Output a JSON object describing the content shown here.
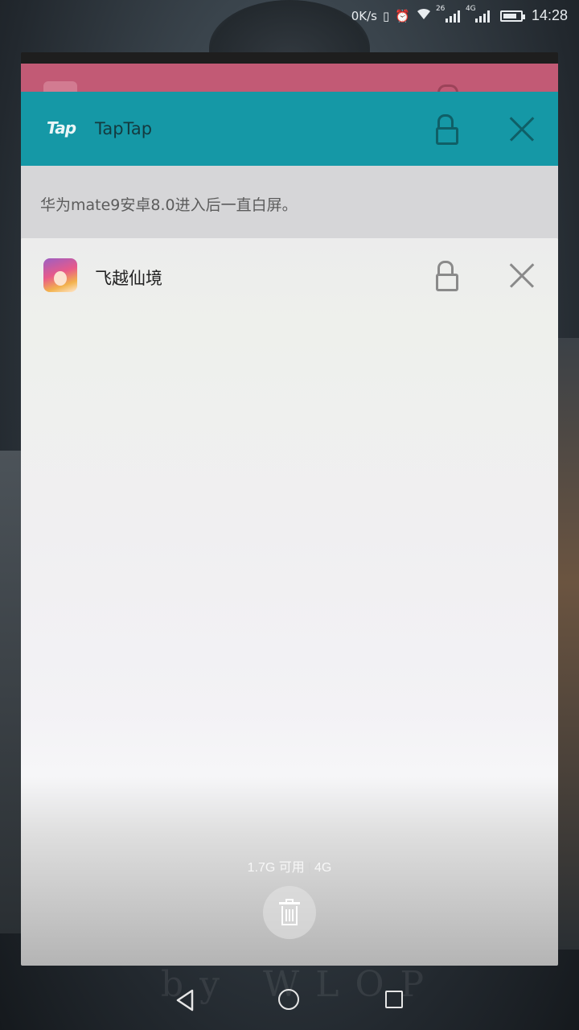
{
  "status_bar": {
    "net_speed": "0K/s",
    "sim1_label": "26",
    "sim2_label": "4G",
    "time": "14:28"
  },
  "cards": {
    "taptap": {
      "logo": "Tap",
      "title": "TapTap",
      "preview_text": "华为mate9安卓8.0进入后一直白屏。"
    },
    "main": {
      "title": "飞越仙境"
    }
  },
  "memory": {
    "available": "1.7G 可用",
    "separator": "|",
    "total": "4G"
  },
  "wallpaper_watermark": "by WLOP",
  "colors": {
    "taptap_header": "#1598a6",
    "pink_card": "#c25a75"
  },
  "icons": {
    "lock": "lock-open-icon",
    "close": "close-icon",
    "trash": "trash-icon"
  }
}
